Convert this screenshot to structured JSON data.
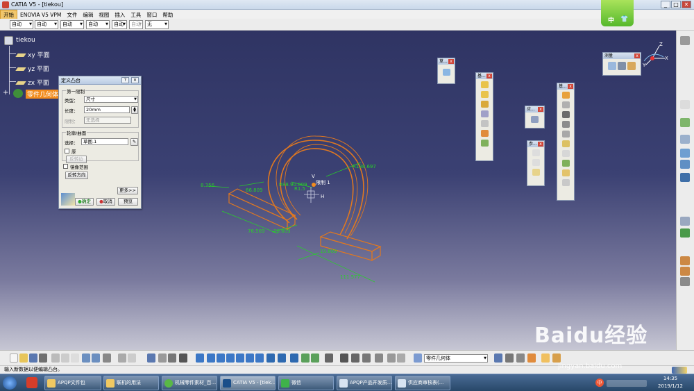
{
  "window": {
    "title": "CATIA V5 - [tiekou]",
    "min": "_",
    "max": "□",
    "close": "✕"
  },
  "menu": {
    "items": [
      "开始",
      "ENOVIA V5 VPM",
      "文件",
      "编辑",
      "视图",
      "插入",
      "工具",
      "窗口",
      "帮助"
    ]
  },
  "dropdowns": [
    {
      "value": "自动"
    },
    {
      "value": "自动"
    },
    {
      "value": "自动"
    },
    {
      "value": "自动"
    },
    {
      "value": "自动"
    },
    {
      "value": "自动"
    },
    {
      "value": "无"
    }
  ],
  "tree": {
    "root": "tiekou",
    "items": [
      {
        "label": "xy 平面"
      },
      {
        "label": "yz 平面"
      },
      {
        "label": "zx 平面"
      },
      {
        "label": "零件几何体"
      }
    ]
  },
  "dialog": {
    "title": "定义凸台",
    "help": "?",
    "close": "✕",
    "first_limit": {
      "group": "第一限制",
      "type_label": "类型：",
      "type_value": "尺寸",
      "length_label": "长度：",
      "length_value": "20mm",
      "limit_label": "限制：",
      "limit_value": "无选择"
    },
    "profile": {
      "group": "轮廓/曲面",
      "select_label": "选择：",
      "select_value": "草图.1",
      "thick_label": "厚",
      "reverse_side": "反转边"
    },
    "mirror_label": "镜像范围",
    "reverse_dir": "反转方向",
    "more": "更多>>",
    "ok": "确定",
    "cancel": "取消",
    "preview": "预览"
  },
  "floating_toolbars": [
    {
      "title": "草..."
    },
    {
      "title": "基..."
    },
    {
      "title": "应..."
    },
    {
      "title": "参..."
    },
    {
      "title": "基..."
    },
    {
      "title": "测量"
    }
  ],
  "dimensions": [
    "8.356",
    "66.809",
    "R88.90.809",
    "R1.5",
    "R138.697",
    "76.569",
    "20.609",
    "19.609",
    "111.577"
  ],
  "model_labels": {
    "limit": "限制 1",
    "h": "H",
    "v": "V"
  },
  "compass": {
    "x": "X",
    "y": "Y",
    "z": "Z"
  },
  "bottom_toolbar": {
    "body_select": "零件几何体"
  },
  "status_text": "输入新数据以便编辑凸台。",
  "taskbar": {
    "items": [
      "APQP文件包",
      "联机的用法",
      "机械零件素材_百...",
      "CATIA V5 - [tiek...",
      "微信",
      "APQP产品开发质...",
      "供应商审核表(...",
      "中"
    ],
    "time": "14:35",
    "date": "2019/1/12"
  },
  "lang_badge": "中",
  "watermark": {
    "brand": "Baidu经验",
    "url": "jingyan.baidu.com"
  },
  "colors": {
    "viewport_top": "#2f3463",
    "viewport_bottom": "#c7c7d4",
    "model_orange": "#e07820",
    "dimension_green": "#28d028",
    "highlight": "#f28c1e"
  }
}
